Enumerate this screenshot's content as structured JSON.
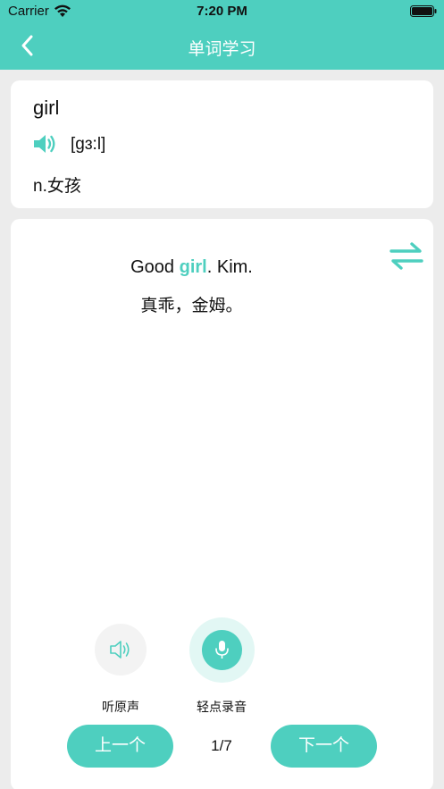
{
  "status_bar": {
    "carrier": "Carrier",
    "time": "7:20 PM"
  },
  "nav": {
    "title": "单词学习",
    "back_icon": "chevron-left-icon"
  },
  "word": {
    "text": "girl",
    "phonetic": "[gɜ:l]",
    "meaning": "n.女孩",
    "speaker_icon": "speaker-icon"
  },
  "sentence": {
    "en_before": "Good ",
    "en_highlight": "girl",
    "en_after": ". Kim.",
    "cn": "真乖，金姆。"
  },
  "controls": {
    "play_label": "听原声",
    "record_label": "轻点录音",
    "prev_label": "上一个",
    "next_label": "下一个",
    "page_counter": "1/7",
    "swap_icon": "swap-arrows-icon",
    "play_icon": "speaker-outline-icon",
    "record_icon": "microphone-icon"
  },
  "colors": {
    "accent": "#4ecfbf",
    "background": "#ececec",
    "card": "#ffffff"
  }
}
